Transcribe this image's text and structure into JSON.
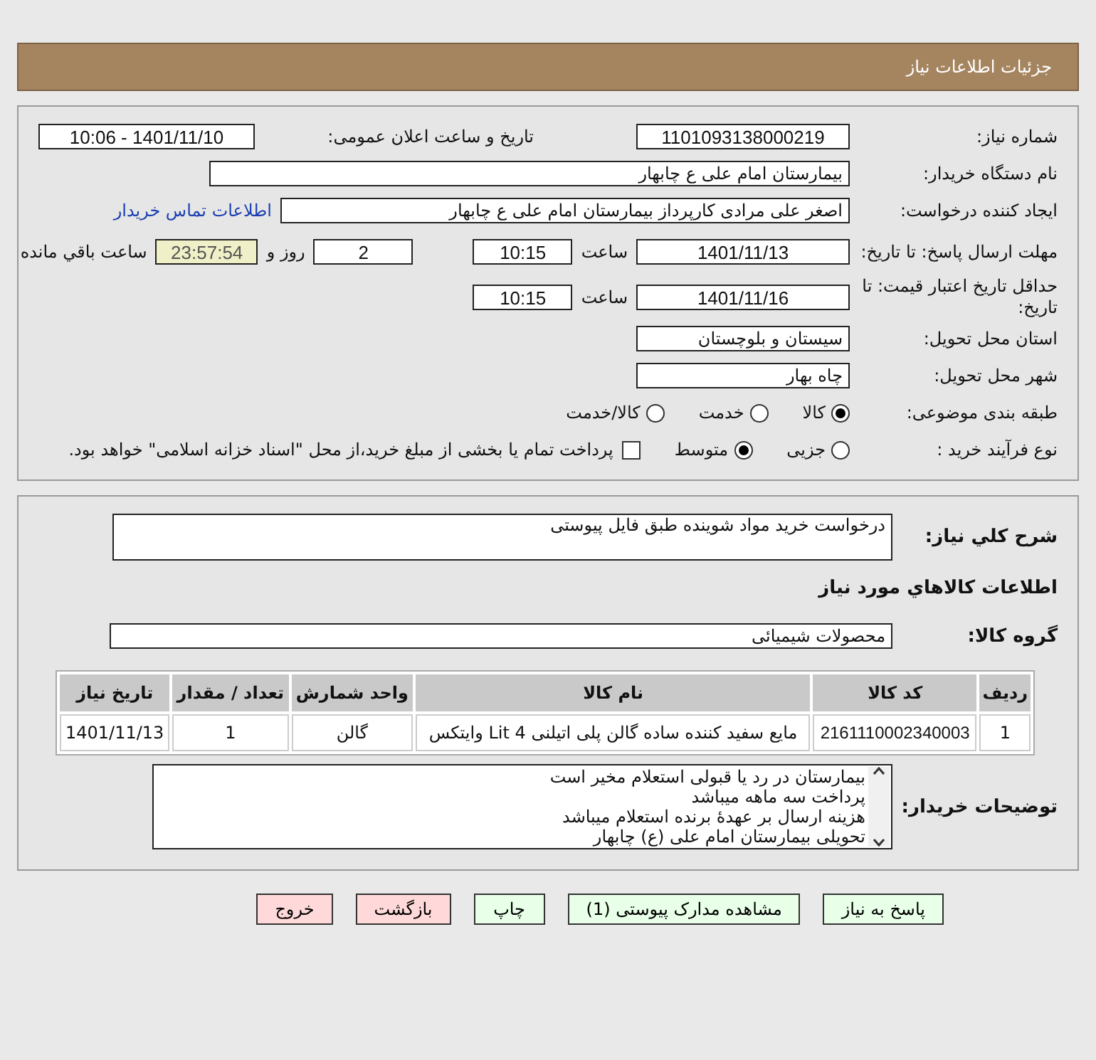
{
  "page_title": "جزئیات اطلاعات نیاز",
  "need_number": {
    "label": "شماره نیاز:",
    "value": "1101093138000219"
  },
  "announce": {
    "label": "تاریخ و ساعت اعلان عمومی:",
    "value": "1401/11/10 - 10:06"
  },
  "buyer_org": {
    "label": "نام دستگاه خریدار:",
    "value": "بیمارستان امام علی  ع  چابهار"
  },
  "requester": {
    "label": "ایجاد کننده درخواست:",
    "value": "اصغر علی مرادی کارپرداز بیمارستان امام علی  ع  چابهار",
    "link": "اطلاعات تماس خریدار"
  },
  "reply_deadline": {
    "label": "مهلت ارسال پاسخ: تا تاریخ:",
    "date": "1401/11/13",
    "time_label": "ساعت",
    "time": "10:15",
    "days": "2",
    "days_label": "روز و",
    "remaining": "23:57:54",
    "remaining_label": "ساعت باقي مانده"
  },
  "price_validity": {
    "label": "حداقل تاریخ اعتبار قیمت: تا تاریخ:",
    "date": "1401/11/16",
    "time_label": "ساعت",
    "time": "10:15"
  },
  "province": {
    "label": "استان محل تحویل:",
    "value": "سیستان و بلوچستان"
  },
  "city": {
    "label": "شهر محل تحویل:",
    "value": "چاه بهار"
  },
  "category": {
    "label": "طبقه بندی موضوعی:",
    "options": [
      {
        "label": "کالا",
        "selected": true
      },
      {
        "label": "خدمت",
        "selected": false
      },
      {
        "label": "کالا/خدمت",
        "selected": false
      }
    ]
  },
  "process": {
    "label": "نوع فرآیند خرید :",
    "options": [
      {
        "label": "جزیی",
        "selected": false
      },
      {
        "label": "متوسط",
        "selected": true
      }
    ],
    "treasury": {
      "label": "پرداخت تمام یا بخشی از مبلغ خرید،از محل \"اسناد خزانه اسلامی\" خواهد بود.",
      "checked": false
    }
  },
  "description": {
    "label": "شرح کلي نیاز:",
    "value": "درخواست خرید مواد شوینده طبق فایل پیوستی"
  },
  "goods_heading": "اطلاعات کالاهاي مورد نیاز",
  "goods_group": {
    "label": "گروه کالا:",
    "value": "محصولات شیمیائی"
  },
  "table": {
    "columns": [
      "ردیف",
      "کد کالا",
      "نام کالا",
      "واحد شمارش",
      "تعداد / مقدار",
      "تاریخ نیاز"
    ],
    "rows": [
      [
        "1",
        "2161110002340003",
        "مایع سفید کننده ساده گالن پلی اتیلنی 4 Lit وایتکس",
        "گالن",
        "1",
        "1401/11/13"
      ]
    ]
  },
  "buyer_notes": {
    "label": "توضیحات خریدار:",
    "lines": [
      "بیمارستان در رد یا قبولی استعلام مخیر است",
      "پرداخت سه ماهه میباشد",
      "هزینه ارسال بر عهدهٔ برنده استعلام میباشد",
      "تحویلی بیمارستان امام علی (ع) چابهار"
    ]
  },
  "buttons": [
    {
      "label": "پاسخ به نیاز",
      "kind": "action"
    },
    {
      "label": "مشاهده مدارک پیوستی (1)",
      "kind": "action"
    },
    {
      "label": "چاپ",
      "kind": "action"
    },
    {
      "label": "بازگشت",
      "kind": "exit"
    },
    {
      "label": "خروج",
      "kind": "exit"
    }
  ]
}
